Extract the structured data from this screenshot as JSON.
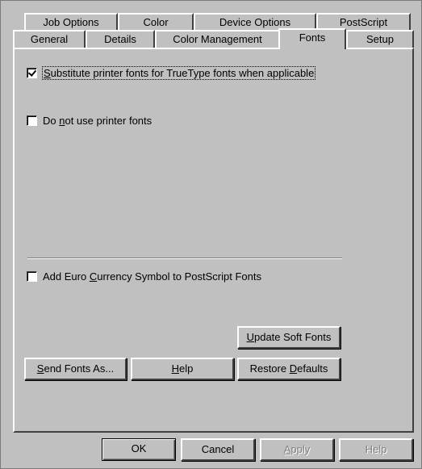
{
  "tabs_row1": [
    "Job Options",
    "Color",
    "Device Options",
    "PostScript"
  ],
  "tabs_row2": [
    "General",
    "Details",
    "Color Management",
    "Fonts",
    "Setup"
  ],
  "active_tab": "Fonts",
  "options": {
    "substitute": {
      "checked": true,
      "pre": "",
      "key": "S",
      "post": "ubstitute printer fonts for TrueType fonts when applicable"
    },
    "no_printer_fonts": {
      "checked": false,
      "pre": "Do ",
      "key": "n",
      "post": "ot use printer fonts"
    },
    "euro": {
      "checked": false,
      "pre": "Add Euro ",
      "key": "C",
      "post": "urrency Symbol to PostScript Fonts"
    }
  },
  "buttons": {
    "update_soft_fonts": {
      "pre": "",
      "key": "U",
      "post": "pdate Soft Fonts"
    },
    "send_fonts_as": {
      "pre": "",
      "key": "S",
      "post": "end Fonts As..."
    },
    "help_inner": {
      "pre": "",
      "key": "H",
      "post": "elp"
    },
    "restore_defaults": {
      "pre": "Restore ",
      "key": "D",
      "post": "efaults"
    }
  },
  "footer": {
    "ok": "OK",
    "cancel": "Cancel",
    "apply": {
      "pre": "",
      "key": "A",
      "post": "pply"
    },
    "help": "Help"
  }
}
